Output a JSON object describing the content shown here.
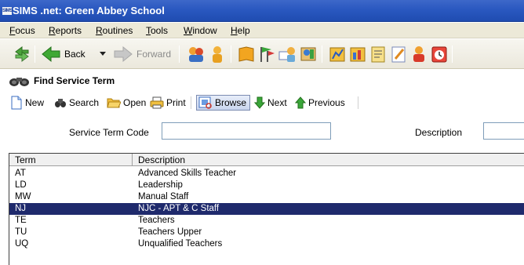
{
  "window": {
    "logo_text": "SIMS",
    "title": "SIMS .net: Green Abbey School"
  },
  "menu": {
    "items": [
      {
        "label": "Focus"
      },
      {
        "label": "Reports"
      },
      {
        "label": "Routines"
      },
      {
        "label": "Tools"
      },
      {
        "label": "Window"
      },
      {
        "label": "Help"
      }
    ]
  },
  "toolbar": {
    "back_label": "Back",
    "forward_label": "Forward",
    "icons": [
      "refresh-icon",
      "back-arrow-icon",
      "dropdown-arrow-icon",
      "forward-arrow-icon",
      "people-icon",
      "person-icon",
      "book-icon",
      "flags-icon",
      "mail-person-icon",
      "staff-icon",
      "finance-icon",
      "assessment-icon",
      "document-icon",
      "notes-icon",
      "pupil-icon",
      "timetable-icon"
    ]
  },
  "panel": {
    "title": "Find Service Term"
  },
  "commands": {
    "new": "New",
    "search": "Search",
    "open": "Open",
    "print": "Print",
    "browse": "Browse",
    "next": "Next",
    "previous": "Previous"
  },
  "search": {
    "code_label": "Service Term Code",
    "code_value": "",
    "description_label": "Description",
    "description_value": ""
  },
  "grid": {
    "columns": [
      "Term",
      "Description"
    ],
    "rows": [
      {
        "term": "AT",
        "description": "Advanced Skills Teacher",
        "selected": false
      },
      {
        "term": "LD",
        "description": "Leadership",
        "selected": false
      },
      {
        "term": "MW",
        "description": "Manual Staff",
        "selected": false
      },
      {
        "term": "NJ",
        "description": "NJC - APT & C Staff",
        "selected": true
      },
      {
        "term": "TE",
        "description": "Teachers",
        "selected": false
      },
      {
        "term": "TU",
        "description": "Teachers Upper",
        "selected": false
      },
      {
        "term": "UQ",
        "description": "Unqualified Teachers",
        "selected": false
      }
    ]
  },
  "colors": {
    "titlebar": "#2a58c0",
    "selection": "#1f2a6c",
    "chrome": "#ece9d8"
  }
}
